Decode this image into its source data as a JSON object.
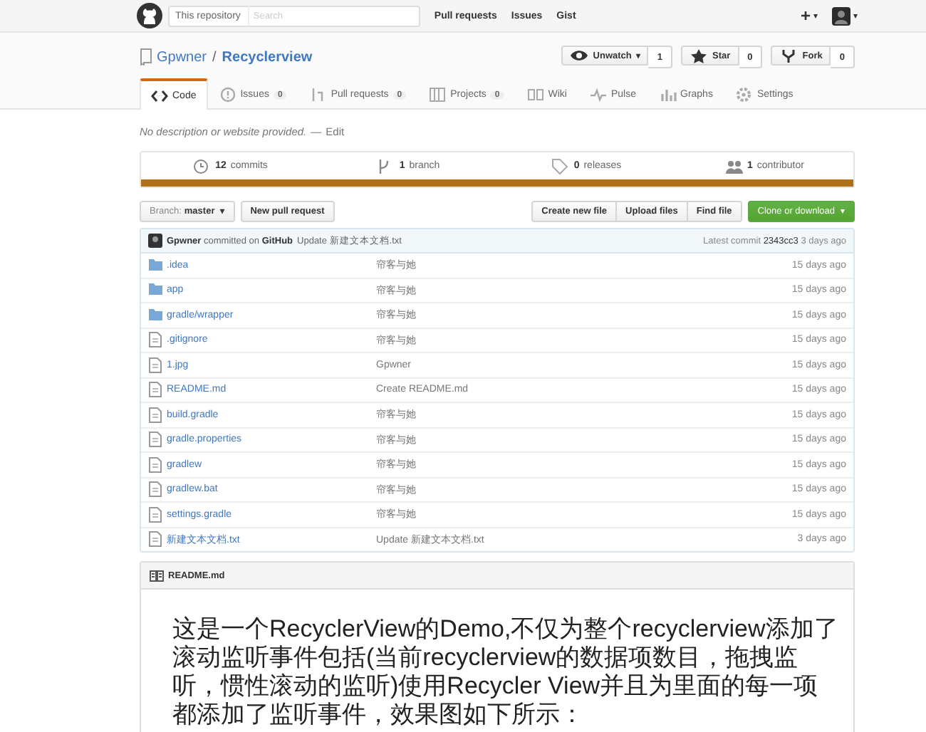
{
  "header": {
    "search_scope": "This repository",
    "search_placeholder": "Search",
    "nav": [
      "Pull requests",
      "Issues",
      "Gist"
    ],
    "plus": "+",
    "caret": "▾"
  },
  "repo": {
    "owner": "Gpwner",
    "separator": "/",
    "name": "Recyclerview",
    "actions": [
      {
        "label": "Unwatch",
        "kind": "watch",
        "count": "1"
      },
      {
        "label": "Star",
        "kind": "star",
        "count": "0"
      },
      {
        "label": "Fork",
        "kind": "fork",
        "count": "0"
      }
    ]
  },
  "tabs": [
    {
      "label": "Code",
      "kind": "code",
      "selected": true
    },
    {
      "label": "Issues",
      "kind": "issues",
      "count": "0",
      "selected": false
    },
    {
      "label": "Pull requests",
      "kind": "pr",
      "count": "0",
      "selected": false
    },
    {
      "label": "Projects",
      "kind": "projects",
      "count": "0",
      "selected": false
    },
    {
      "label": "Wiki",
      "kind": "wiki",
      "selected": false
    },
    {
      "label": "Pulse",
      "kind": "pulse",
      "selected": false
    },
    {
      "label": "Graphs",
      "kind": "graphs",
      "selected": false
    },
    {
      "label": "Settings",
      "kind": "settings",
      "selected": false
    }
  ],
  "description": {
    "text": "No description or website provided.",
    "dash": "—",
    "edit": "Edit"
  },
  "summary": [
    {
      "kind": "commits",
      "number": "12",
      "label": "commits"
    },
    {
      "kind": "branch",
      "number": "1",
      "label": "branch"
    },
    {
      "kind": "releases",
      "number": "0",
      "label": "releases"
    },
    {
      "kind": "contributor",
      "number": "1",
      "label": "contributor"
    }
  ],
  "toolbar": {
    "branch_label": "Branch:",
    "branch": "master",
    "new_pr": "New pull request",
    "buttons": [
      "Create new file",
      "Upload files",
      "Find file"
    ],
    "clone": "Clone or download"
  },
  "latest_commit": {
    "author": "Gpwner",
    "middle": "committed on",
    "platform": "GitHub",
    "message": "Update 新建文本文档.txt",
    "label": "Latest commit",
    "sha": "2343cc3",
    "age": "3 days ago"
  },
  "files": [
    {
      "kind": "folder",
      "name": ".idea",
      "message": "帘客与她",
      "age": "15 days ago"
    },
    {
      "kind": "folder",
      "name": "app",
      "message": "帘客与她",
      "age": "15 days ago"
    },
    {
      "kind": "folder",
      "name": "gradle/wrapper",
      "message": "帘客与她",
      "age": "15 days ago"
    },
    {
      "kind": "file",
      "name": ".gitignore",
      "message": "帘客与她",
      "age": "15 days ago"
    },
    {
      "kind": "file",
      "name": "1.jpg",
      "message": "Gpwner",
      "age": "15 days ago"
    },
    {
      "kind": "file",
      "name": "README.md",
      "message": "Create README.md",
      "age": "15 days ago"
    },
    {
      "kind": "file",
      "name": "build.gradle",
      "message": "帘客与她",
      "age": "15 days ago"
    },
    {
      "kind": "file",
      "name": "gradle.properties",
      "message": "帘客与她",
      "age": "15 days ago"
    },
    {
      "kind": "file",
      "name": "gradlew",
      "message": "帘客与她",
      "age": "15 days ago"
    },
    {
      "kind": "file",
      "name": "gradlew.bat",
      "message": "帘客与她",
      "age": "15 days ago"
    },
    {
      "kind": "file",
      "name": "settings.gradle",
      "message": "帘客与她",
      "age": "15 days ago"
    },
    {
      "kind": "file",
      "name": "新建文本文档.txt",
      "message": "Update 新建文本文档.txt",
      "age": "3 days ago"
    }
  ],
  "readme": {
    "title": "README.md",
    "heading": "这是一个RecyclerView的Demo,不仅为整个recyclerview添加了滚动监听事件包括(当前recyclerview的数据项数目，拖拽监听，惯性滚动的监听)使用Recycler View并且为里面的每一项都添加了监听事件，效果图如下所示："
  }
}
